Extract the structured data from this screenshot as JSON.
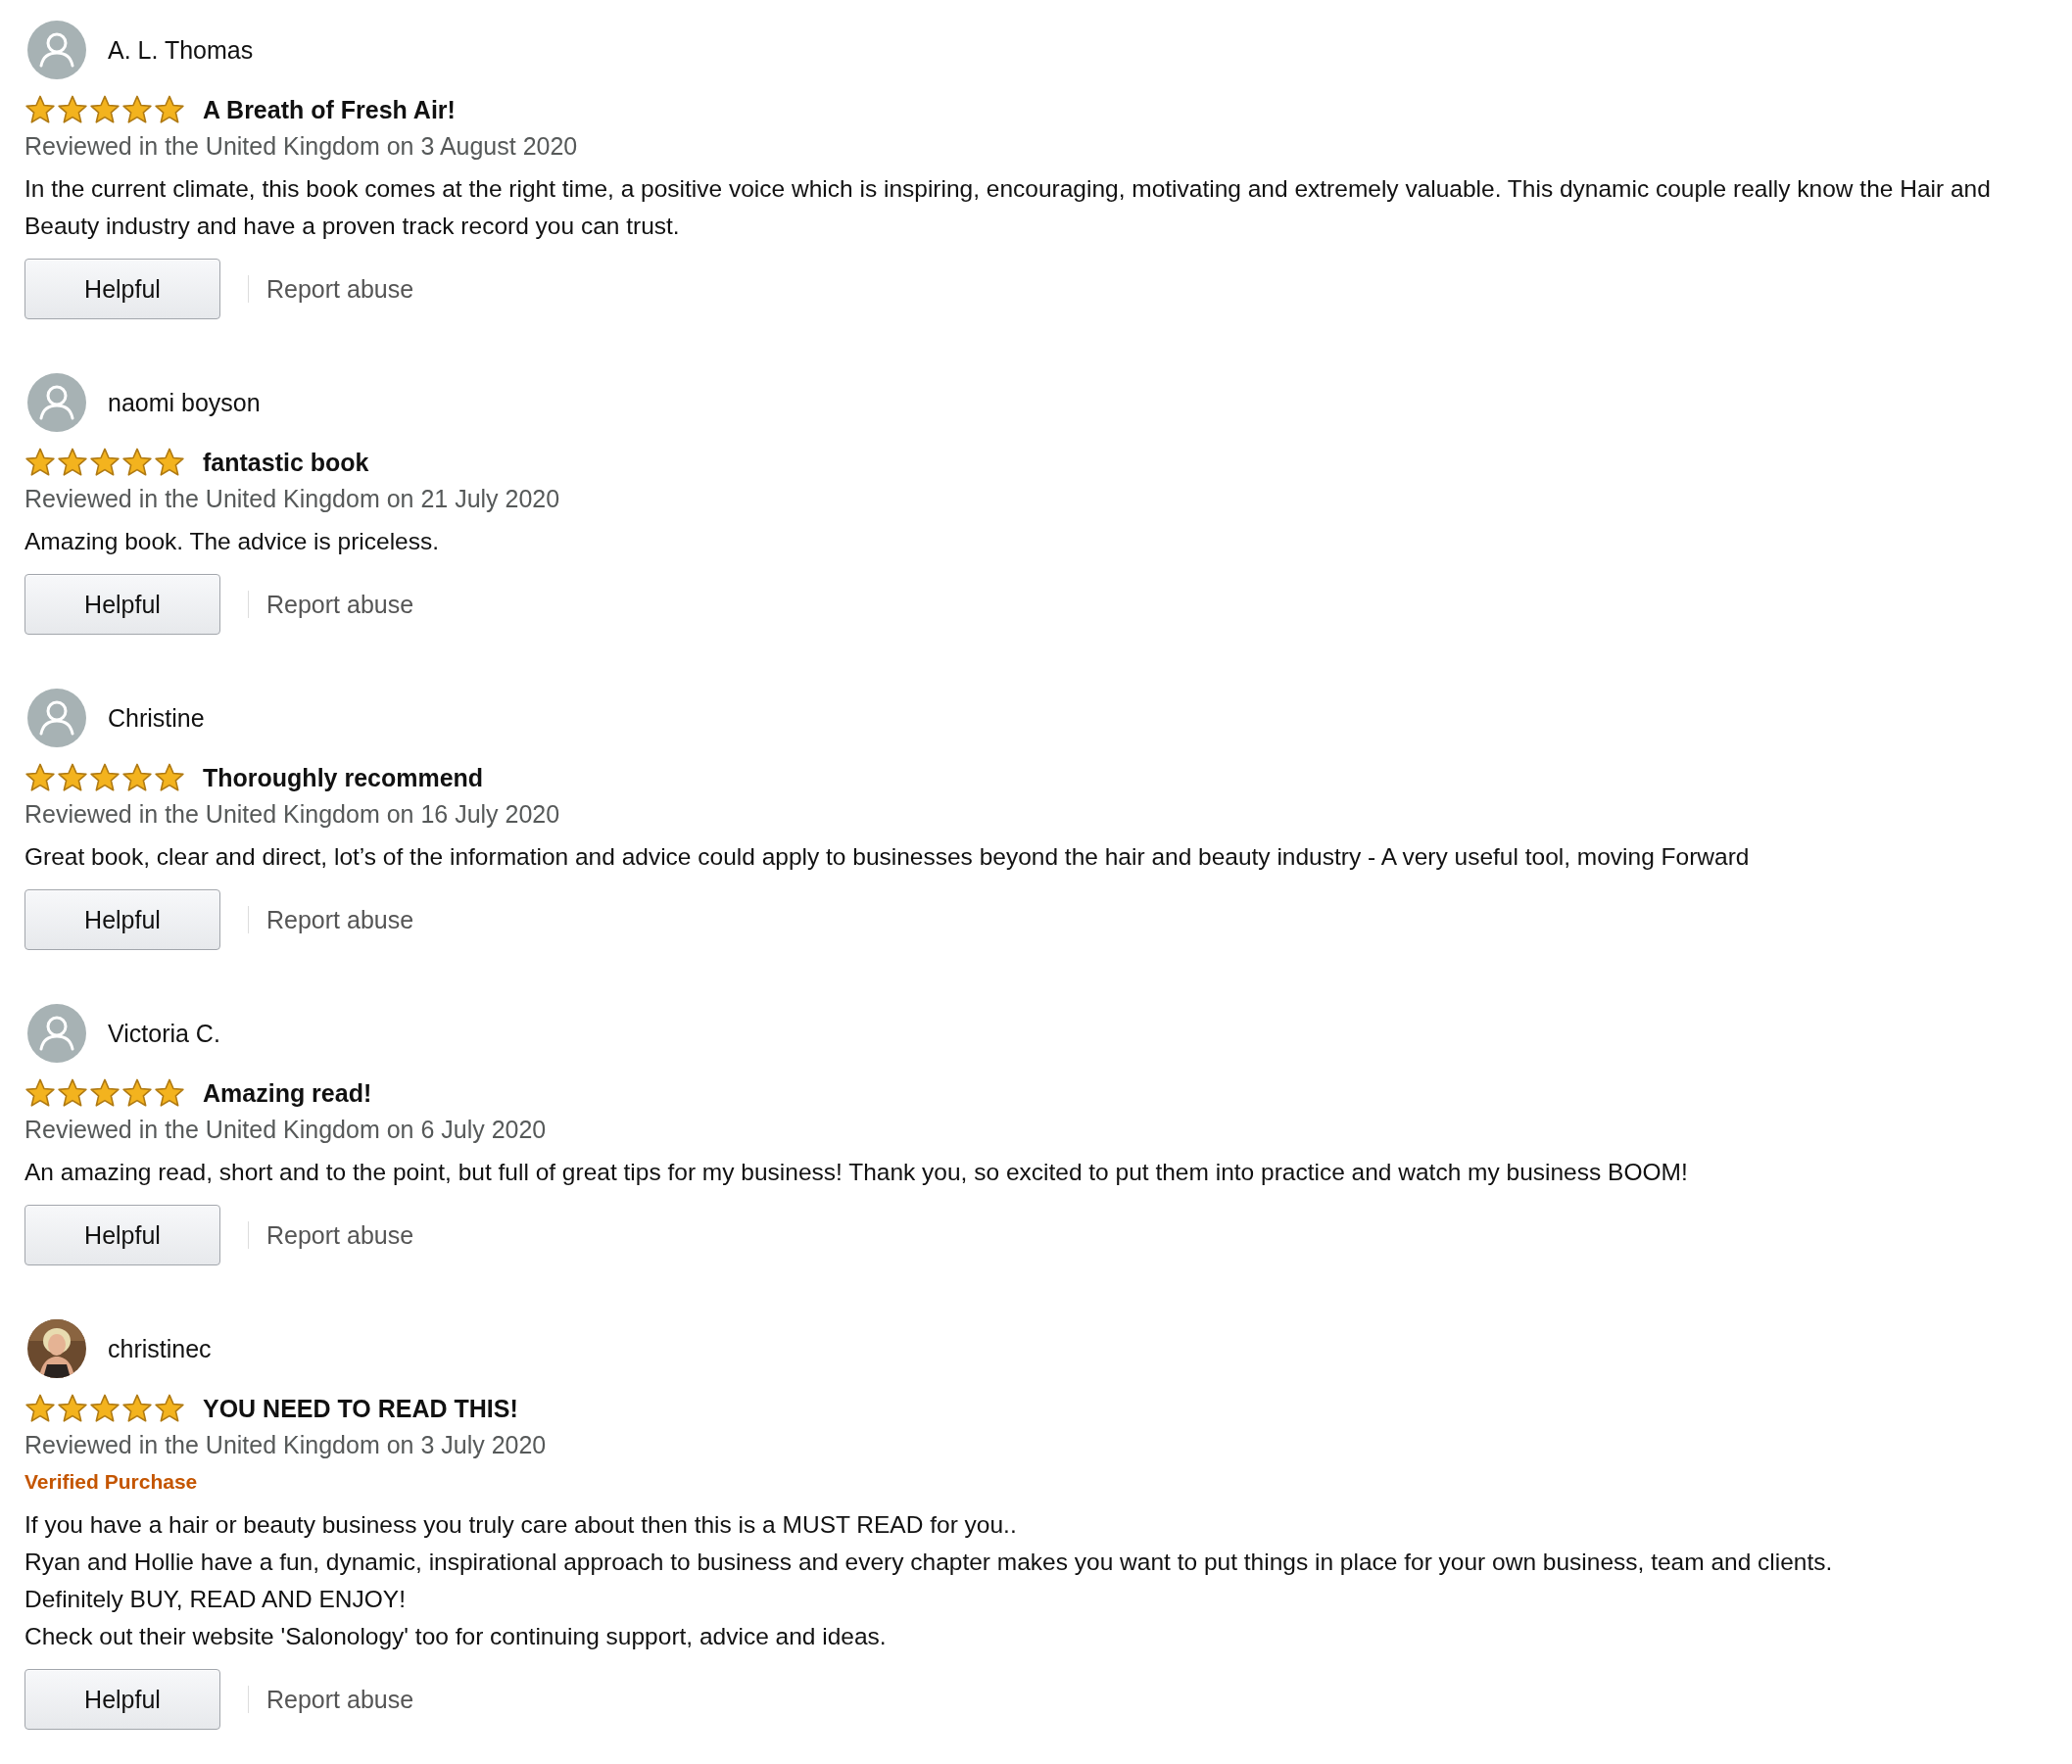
{
  "reviews": [
    {
      "author": "A. L. Thomas",
      "avatar": {
        "kind": "default"
      },
      "stars": 5,
      "title": "A Breath of Fresh Air!",
      "date": "Reviewed in the United Kingdom on 3 August 2020",
      "body": [
        "In the current climate, this book comes at the right time, a positive voice which is inspiring, encouraging, motivating and extremely valuable. This dynamic couple really know the Hair and Beauty industry and have a proven track record you can trust."
      ],
      "helpful": "Helpful",
      "report": "Report abuse"
    },
    {
      "author": "naomi boyson",
      "avatar": {
        "kind": "default"
      },
      "stars": 5,
      "title": "fantastic book",
      "date": "Reviewed in the United Kingdom on 21 July 2020",
      "body": [
        "Amazing book. The advice is priceless."
      ],
      "helpful": "Helpful",
      "report": "Report abuse"
    },
    {
      "author": "Christine",
      "avatar": {
        "kind": "default"
      },
      "stars": 5,
      "title": "Thoroughly recommend",
      "date": "Reviewed in the United Kingdom on 16 July 2020",
      "body": [
        "Great book, clear and direct, lot’s of the information and advice could apply to businesses beyond the hair and beauty industry - A very useful tool, moving Forward"
      ],
      "helpful": "Helpful",
      "report": "Report abuse"
    },
    {
      "author": "Victoria C.",
      "avatar": {
        "kind": "default"
      },
      "stars": 5,
      "title": "Amazing read!",
      "date": "Reviewed in the United Kingdom on 6 July 2020",
      "body": [
        "An amazing read, short and to the point, but full of great tips for my business! Thank you, so excited to put them into practice and watch my business BOOM!"
      ],
      "helpful": "Helpful",
      "report": "Report abuse"
    },
    {
      "author": "christinec",
      "avatar": {
        "kind": "picture"
      },
      "stars": 5,
      "title": "YOU NEED TO READ THIS!",
      "date": "Reviewed in the United Kingdom on 3 July 2020",
      "badge": "Verified Purchase",
      "body": [
        "If you have a hair or beauty business you truly care about then this is a MUST READ for you..",
        "Ryan and Hollie have a fun, dynamic, inspirational approach to business and every chapter makes you want to put things in place for your own business, team and clients.",
        "Definitely BUY, READ AND ENJOY!",
        "Check out their website 'Salonology' too for continuing support, advice and ideas."
      ],
      "helpful": "Helpful",
      "report": "Report abuse"
    }
  ]
}
